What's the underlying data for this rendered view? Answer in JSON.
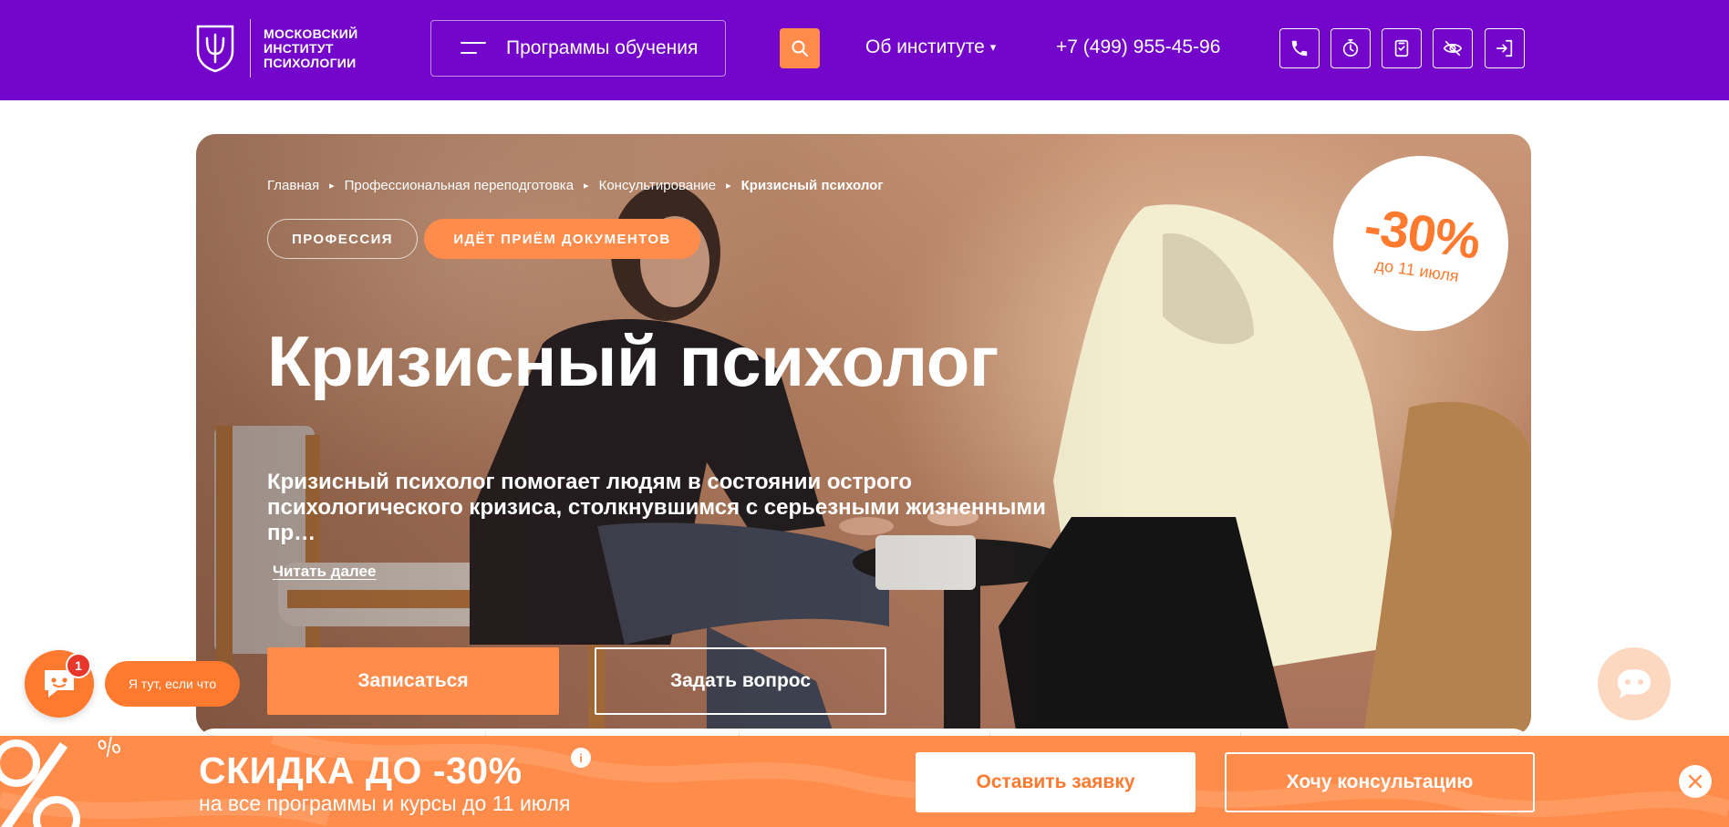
{
  "header": {
    "logo_lines": [
      "МОСКОВСКИЙ",
      "ИНСТИТУТ",
      "ПСИХОЛОГИИ"
    ],
    "programs_label": "Программы обучения",
    "about_label": "Об институте",
    "about_caret": "▾",
    "phone": "+7 (499) 955-45-96",
    "icons": [
      "phone-icon",
      "timer-icon",
      "document-check-icon",
      "eye-off-icon",
      "login-icon"
    ]
  },
  "hero": {
    "breadcrumb": [
      "Главная",
      "Профессиональная переподготовка",
      "Консультирование",
      "Кризисный психолог"
    ],
    "breadcrumb_sep": "▸",
    "chip_profession": "ПРОФЕССИЯ",
    "chip_status": "ИДЁТ ПРИЁМ ДОКУМЕНТОВ",
    "title": "Кризисный психолог",
    "description": "Кризисный психолог помогает людям в состоянии острого психологического кризиса, столкнувшимся с серьезными жизненными пр…",
    "read_more": "Читать далее",
    "enroll_label": "Записаться",
    "ask_label": "Задать вопрос",
    "discount": {
      "value": "-30%",
      "until": "до 11 июля"
    }
  },
  "chat": {
    "badge_count": "1",
    "label": "Я тут, если что"
  },
  "promo": {
    "title": "СКИДКА ДО -30%",
    "info": "i",
    "subtitle": "на все программы и курсы до 11 июля",
    "apply_label": "Оставить заявку",
    "consult_label": "Хочу консультацию"
  },
  "colors": {
    "brand_purple": "#7406cb",
    "accent_orange": "#ff8c4b",
    "badge_red": "#e8362b"
  }
}
